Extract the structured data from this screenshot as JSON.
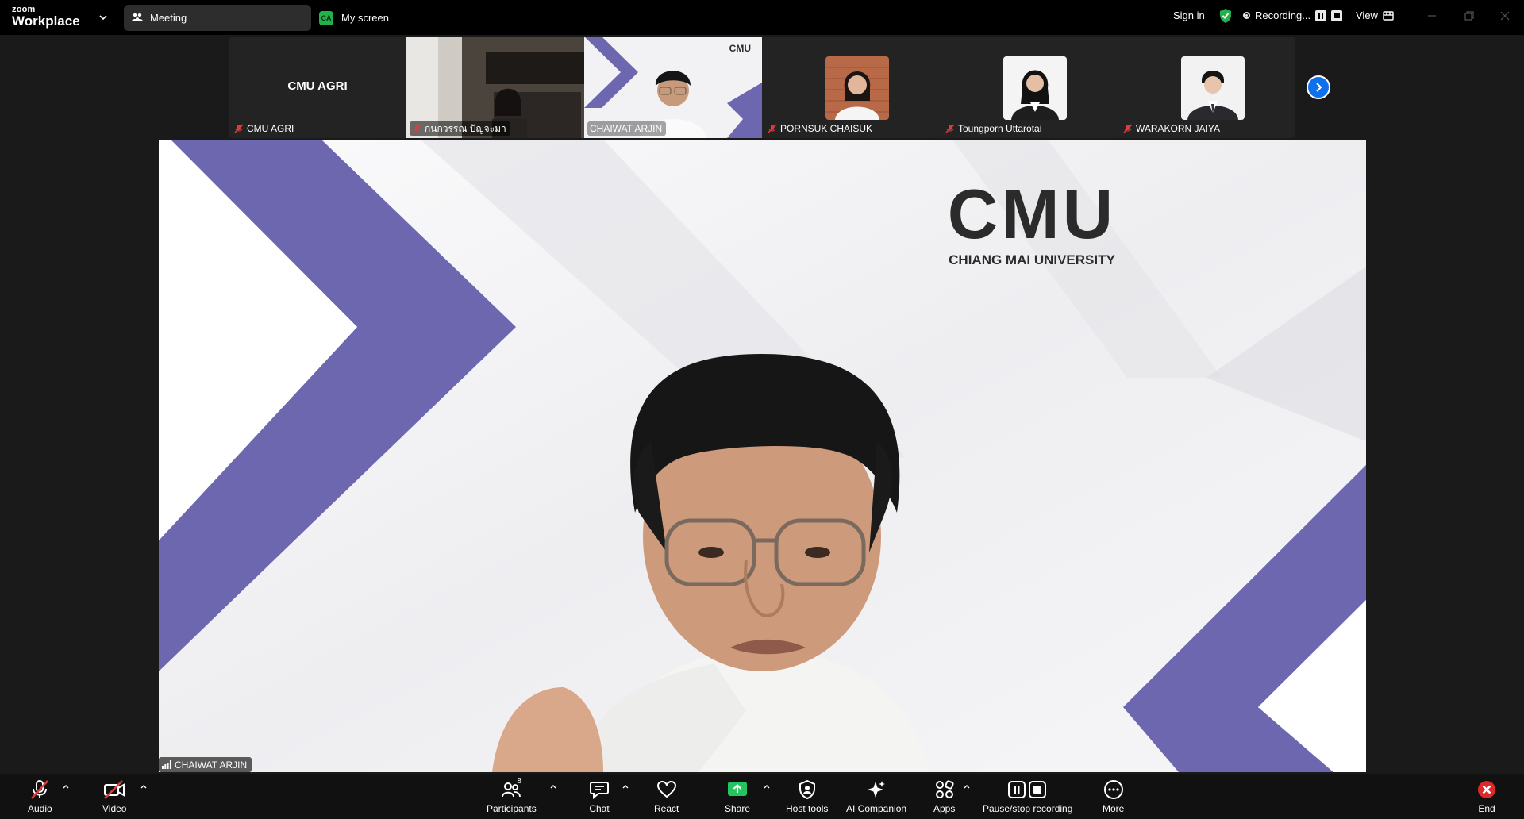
{
  "app": {
    "logo_top": "zoom",
    "logo_bottom": "Workplace"
  },
  "tabs": {
    "meeting": "Meeting",
    "screen_badge": "CA",
    "screen": "My screen"
  },
  "topbar": {
    "sign_in": "Sign in",
    "recording": "Recording...",
    "view": "View"
  },
  "gallery": {
    "tiles": [
      {
        "name": "CMU AGRI",
        "title": "CMU AGRI",
        "muted": true
      },
      {
        "name": "กนกวรรณ ปัญจะมา",
        "muted": true
      },
      {
        "name": "CHAIWAT ARJIN",
        "muted": false,
        "active": true,
        "logo": "CMU"
      },
      {
        "name": "PORNSUK CHAISUK",
        "muted": true
      },
      {
        "name": "Toungporn Uttarotai",
        "muted": true
      },
      {
        "name": "WARAKORN JAIYA",
        "muted": true
      }
    ]
  },
  "main": {
    "logo_text": "CMU",
    "university": "CHIANG MAI UNIVERSITY",
    "speaker": "CHAIWAT ARJIN"
  },
  "toolbar": {
    "audio": "Audio",
    "video": "Video",
    "participants": "Participants",
    "participants_count": "8",
    "chat": "Chat",
    "react": "React",
    "share": "Share",
    "host_tools": "Host tools",
    "ai_companion": "AI Companion",
    "apps": "Apps",
    "pause_stop": "Pause/stop recording",
    "more": "More",
    "end": "End"
  },
  "colors": {
    "accent_green": "#22d48c",
    "brand_purple": "#6d67b0",
    "blue": "#0e71eb",
    "end_red": "#e02828"
  }
}
